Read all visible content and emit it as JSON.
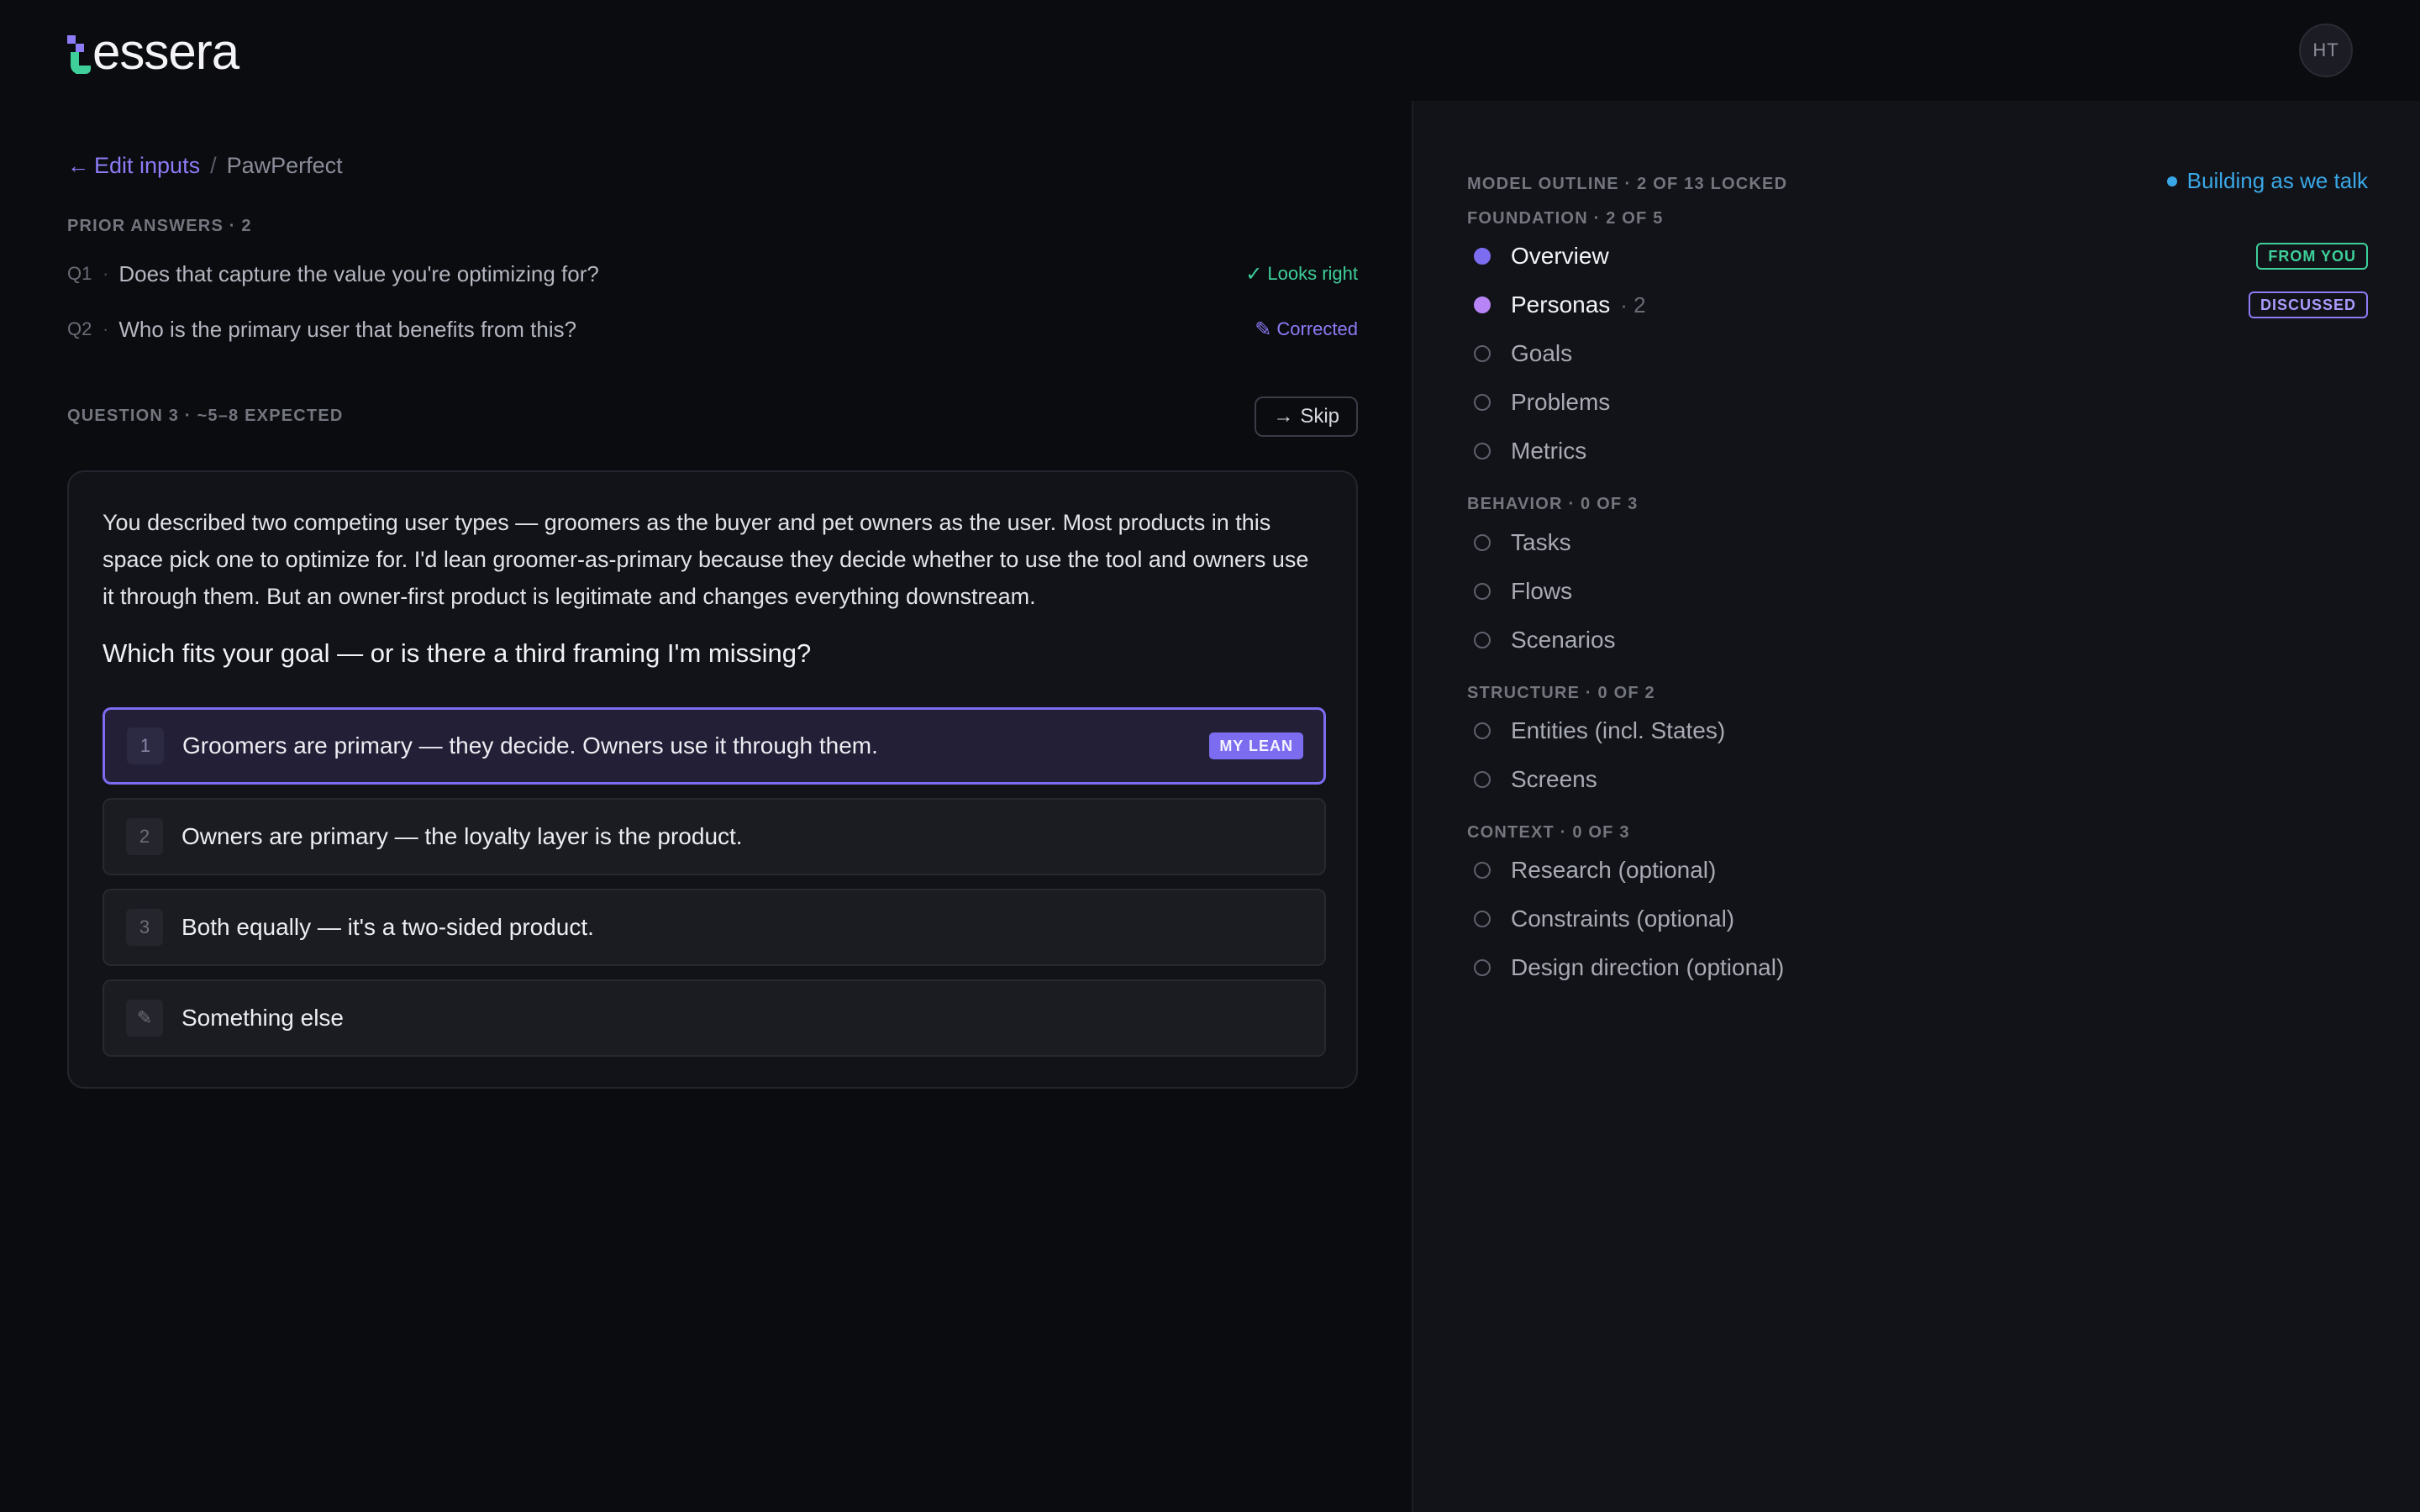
{
  "brand": {
    "name": "essera",
    "colors": {
      "accent": "#7c6cf0",
      "success": "#3ecf9a",
      "info": "#3aa8e8"
    }
  },
  "user": {
    "initials": "HT"
  },
  "breadcrumb": {
    "back_label": "Edit inputs",
    "current": "PawPerfect",
    "separator": "/"
  },
  "prior": {
    "label": "PRIOR ANSWERS · 2",
    "items": [
      {
        "num": "Q1",
        "text": "Does that capture the value you're optimizing for?",
        "status": "Looks right",
        "icon": "check-icon"
      },
      {
        "num": "Q2",
        "text": "Who is the primary user that benefits from this?",
        "status": "Corrected",
        "icon": "pencil-icon"
      }
    ]
  },
  "question": {
    "label": "QUESTION 3 · ~5–8 EXPECTED",
    "skip_label": "Skip",
    "intro": "You described two competing user types — groomers as the buyer and pet owners as the user. Most products in this space pick one to optimize for. I'd lean groomer-as-primary because they decide whether to use the tool and owners use it through them. But an owner-first product is legitimate and changes everything downstream.",
    "prompt": "Which fits your goal — or is there a third framing I'm missing?",
    "options": [
      {
        "key": "1",
        "text": "Groomers are primary — they decide. Owners use it through them.",
        "badge": "MY LEAN"
      },
      {
        "key": "2",
        "text": "Owners are primary — the loyalty layer is the product."
      },
      {
        "key": "3",
        "text": "Both equally — it's a two-sided product."
      },
      {
        "key": "✎",
        "text": "Something else"
      }
    ]
  },
  "outline": {
    "label": "MODEL OUTLINE · 2 OF 13 LOCKED",
    "live_status": "Building as we talk",
    "groups": [
      {
        "label": "FOUNDATION · 2 OF 5",
        "items": [
          {
            "label": "Overview",
            "tag": "FROM YOU"
          },
          {
            "label": "Personas",
            "count": "· 2",
            "tag": "DISCUSSED"
          },
          {
            "label": "Goals"
          },
          {
            "label": "Problems"
          },
          {
            "label": "Metrics"
          }
        ]
      },
      {
        "label": "BEHAVIOR · 0 OF 3",
        "items": [
          {
            "label": "Tasks"
          },
          {
            "label": "Flows"
          },
          {
            "label": "Scenarios"
          }
        ]
      },
      {
        "label": "STRUCTURE · 0 OF 2",
        "items": [
          {
            "label": "Entities (incl. States)"
          },
          {
            "label": "Screens"
          }
        ]
      },
      {
        "label": "CONTEXT · 0 OF 3",
        "items": [
          {
            "label": "Research (optional)"
          },
          {
            "label": "Constraints (optional)"
          },
          {
            "label": "Design direction (optional)"
          }
        ]
      }
    ]
  }
}
